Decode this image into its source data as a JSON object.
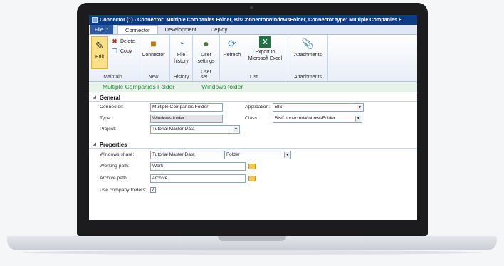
{
  "window": {
    "title": "Connector (1) - Connector: Multiple Companies Folder, BisConnectorWindowsFolder, Connector type: Multiple Companies F"
  },
  "tabs": {
    "file": "File",
    "items": [
      "Connector",
      "Development",
      "Deploy"
    ],
    "active": "Connector"
  },
  "ribbon": {
    "maintain": {
      "label": "Maintain",
      "edit": "Edit",
      "delete": "Delete",
      "copy": "Copy"
    },
    "new": {
      "label": "New",
      "connector": "Connector"
    },
    "history": {
      "label": "History",
      "file_history": "File history"
    },
    "user_setup": {
      "label": "User set...",
      "user_settings": "User settings"
    },
    "list": {
      "label": "List",
      "refresh": "Refresh",
      "export": "Export to Microsoft Excel"
    },
    "attachments": {
      "label": "Attachments",
      "attachments": "Attachments"
    }
  },
  "header": {
    "name": "Multiple Companies Folder",
    "type": "Windows folder"
  },
  "general": {
    "title": "General",
    "connector_label": "Connector:",
    "connector_value": "Multiple Companies Folder",
    "type_label": "Type:",
    "type_value": "Windows folder",
    "project_label": "Project:",
    "project_value": "Tutorial Master Data",
    "application_label": "Application:",
    "application_value": "BIS",
    "class_label": "Class:",
    "class_value": "BisConnectorWindowsFolder"
  },
  "properties": {
    "title": "Properties",
    "share_label": "Windows share:",
    "share_value": "Tutorial Master Data",
    "share_type": "Folder",
    "working_label": "Working path:",
    "working_value": "Work",
    "archive_label": "Archive path:",
    "archive_value": "archive",
    "company_label": "Use company folders:",
    "company_checked": true
  }
}
